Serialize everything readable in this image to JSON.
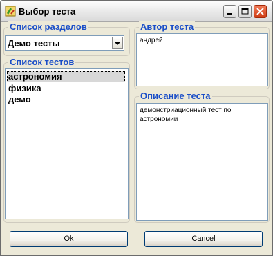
{
  "window": {
    "title": "Выбор теста",
    "icon": "test-app-icon"
  },
  "sections_group": {
    "label": "Список разделов",
    "selected": "Демо тесты"
  },
  "tests_group": {
    "label": "Список тестов",
    "items": [
      "астрономия",
      "физика",
      "демо"
    ],
    "selected_index": 0
  },
  "author_group": {
    "label": "Автор теста",
    "value": "андрей"
  },
  "description_group": {
    "label": "Описание теста",
    "value": "демонстриационный тест по астрономии"
  },
  "buttons": {
    "ok": "Ok",
    "cancel": "Cancel"
  },
  "colors": {
    "group_label": "#1a4ec8",
    "window_bg": "#ece9d8",
    "close_button": "#d03c14"
  }
}
